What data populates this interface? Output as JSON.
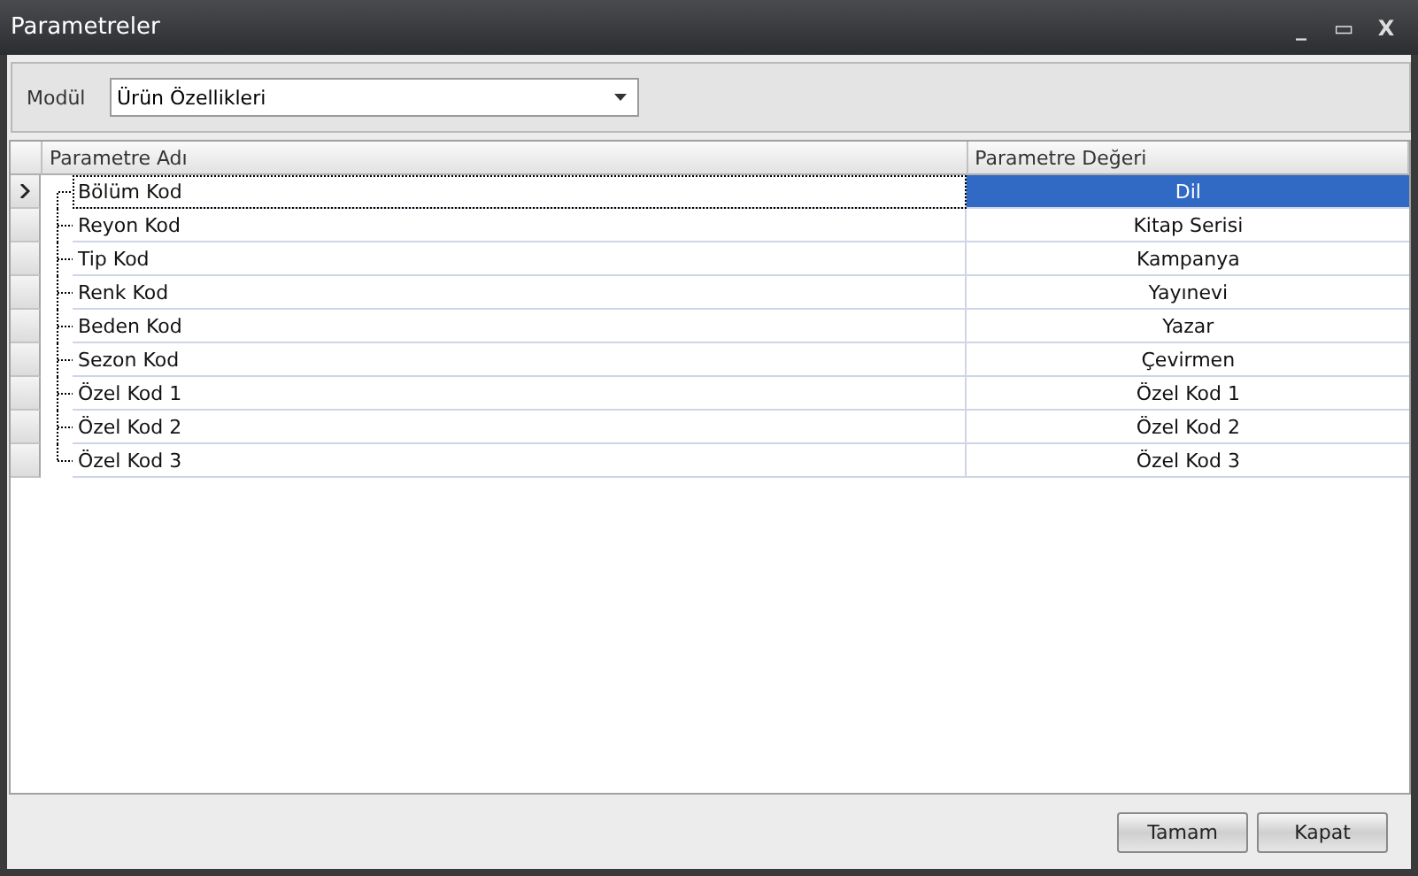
{
  "window": {
    "title": "Parametreler",
    "controls": [
      "_",
      "▭",
      "X"
    ]
  },
  "filter": {
    "label": "Modül",
    "value": "Ürün Özellikleri"
  },
  "table": {
    "columns": [
      "Parametre Adı",
      "Parametre Değeri"
    ],
    "rows": [
      {
        "name": "Bölüm Kod",
        "value": "Dil",
        "selected": true
      },
      {
        "name": "Reyon Kod",
        "value": "Kitap Serisi",
        "selected": false
      },
      {
        "name": "Tip Kod",
        "value": "Kampanya",
        "selected": false
      },
      {
        "name": "Renk Kod",
        "value": "Yayınevi",
        "selected": false
      },
      {
        "name": "Beden Kod",
        "value": "Yazar",
        "selected": false
      },
      {
        "name": "Sezon Kod",
        "value": "Çevirmen",
        "selected": false
      },
      {
        "name": "Özel Kod 1",
        "value": "Özel Kod 1",
        "selected": false
      },
      {
        "name": "Özel Kod 2",
        "value": "Özel Kod 2",
        "selected": false
      },
      {
        "name": "Özel Kod 3",
        "value": "Özel Kod 3",
        "selected": false
      }
    ]
  },
  "buttons": [
    "Tamam",
    "Kapat"
  ]
}
